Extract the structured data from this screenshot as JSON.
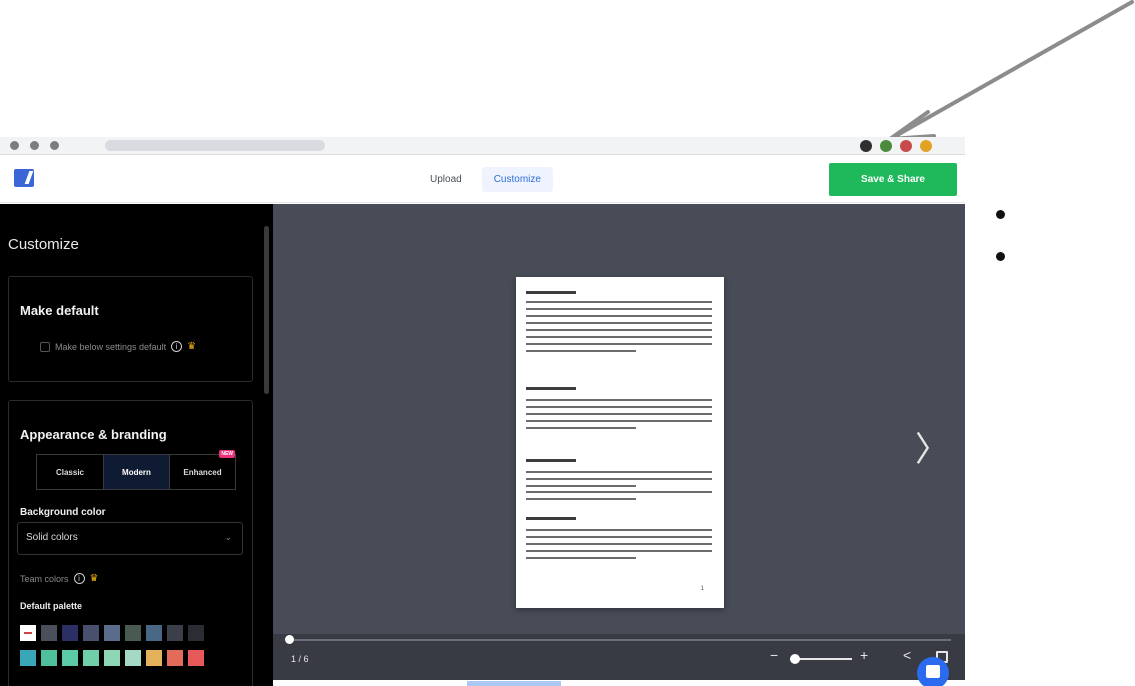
{
  "browser": {
    "extension_colors": [
      "#2f2f2f",
      "#4b8b3b",
      "#c94a4a",
      "#e0a323"
    ]
  },
  "header": {
    "tabs": [
      {
        "label": "Upload",
        "active": false
      },
      {
        "label": "Customize",
        "active": true
      }
    ],
    "save_label": "Save & Share"
  },
  "sidebar": {
    "title": "Customize",
    "make_default": {
      "heading": "Make default",
      "checkbox_label": "Make below settings default",
      "checked": false
    },
    "appearance": {
      "heading": "Appearance & branding",
      "themes": [
        {
          "label": "Classic",
          "active": false
        },
        {
          "label": "Modern",
          "active": true
        },
        {
          "label": "Enhanced",
          "active": false
        }
      ],
      "new_badge": "NEW",
      "background_label": "Background color",
      "background_value": "Solid colors",
      "theme_colors_label": "Team colors",
      "palette_label": "Default palette",
      "palette": [
        "#ffffff",
        "#4a4f5c",
        "#2b2f64",
        "#48506e",
        "#5a6b8c",
        "#4a5a50",
        "#486885",
        "#3a3f4a",
        "#2a2d33",
        "#3aa7b8",
        "#4fbf9c",
        "#5acaa8",
        "#6ecfa8",
        "#8fd6b5",
        "#a6d8c6",
        "#e3b25a",
        "#e46a5a",
        "#e85a5a"
      ]
    }
  },
  "viewer": {
    "page_counter": "1 / 6",
    "page_number": "1",
    "colors": {
      "accent": "#1fb85a",
      "stage": "#484c57"
    }
  }
}
